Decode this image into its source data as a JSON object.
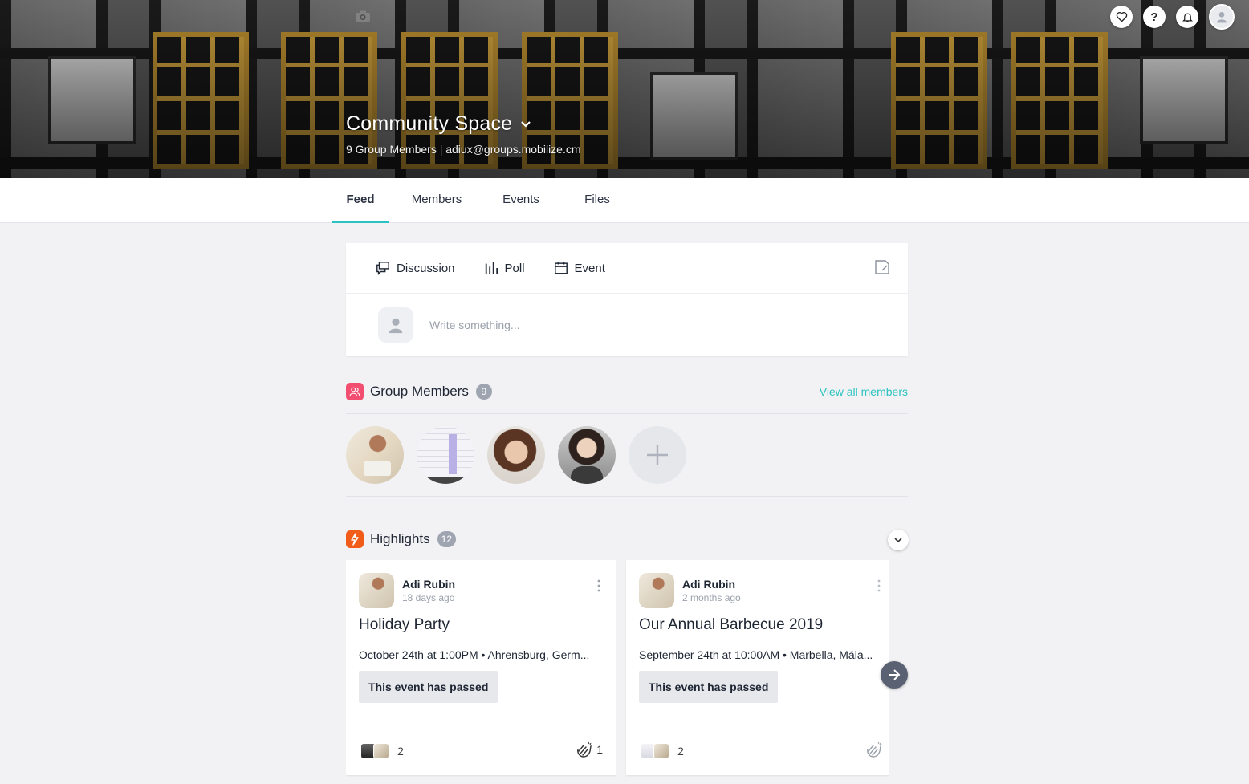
{
  "header": {
    "group_name": "Community Space",
    "group_subtitle": "9 Group Members | adiux@groups.mobilize.cm",
    "icons": [
      "camera-icon",
      "heart-icon",
      "help-icon",
      "bell-icon",
      "user-avatar-icon",
      "chevron-down-icon"
    ],
    "help_label": "?"
  },
  "tabs": [
    {
      "label": "Feed",
      "active": true
    },
    {
      "label": "Members"
    },
    {
      "label": "Events"
    },
    {
      "label": "Files"
    }
  ],
  "composer": {
    "options": [
      {
        "label": "Discussion",
        "icon": "discussion-icon"
      },
      {
        "label": "Poll",
        "icon": "poll-icon"
      },
      {
        "label": "Event",
        "icon": "calendar-icon"
      }
    ],
    "placeholder": "Write something..."
  },
  "members_section": {
    "title": "Group Members",
    "count": "9",
    "view_all": "View all members",
    "accent": "#f24e6f"
  },
  "highlights": {
    "title": "Highlights",
    "count": "12",
    "accent": "#f25c19",
    "cards": [
      {
        "author": "Adi Rubin",
        "time": "18 days ago",
        "title": "Holiday Party",
        "meta": "October 24th at 1:00PM • Ahrensburg, Germ...",
        "status": "This event has passed",
        "attendees": "2",
        "claps": "1"
      },
      {
        "author": "Adi Rubin",
        "time": "2 months ago",
        "title": "Our Annual Barbecue 2019",
        "meta": "September 24th at 10:00AM • Marbella, Mála...",
        "status": "This event has passed",
        "attendees": "2",
        "claps": ""
      }
    ]
  },
  "colors": {
    "accent": "#2bc3c1",
    "next_button": "#5a6172"
  }
}
